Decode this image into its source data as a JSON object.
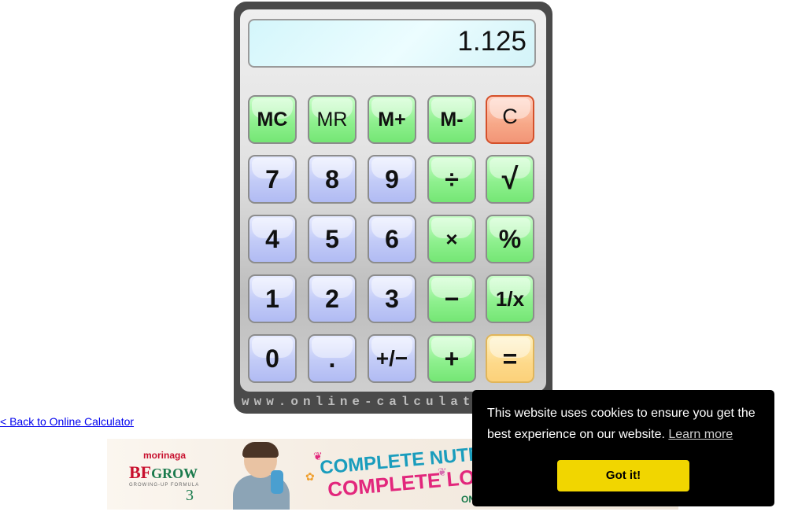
{
  "calculator": {
    "display_value": "1.125",
    "brand_text": "www.online-calculat",
    "keys": {
      "mc": "MC",
      "mr": "MR",
      "mplus": "M+",
      "mminus": "M-",
      "clear": "C",
      "k7": "7",
      "k8": "8",
      "k9": "9",
      "divide": "÷",
      "sqrt": "√",
      "k4": "4",
      "k5": "5",
      "k6": "6",
      "multiply": "×",
      "percent": "%",
      "k1": "1",
      "k2": "2",
      "k3": "3",
      "minus": "−",
      "reciprocal": "1/x",
      "k0": "0",
      "decimal": ".",
      "negate": "+/−",
      "plus": "+",
      "equals": "="
    }
  },
  "back_link": "< Back to Online Calculator",
  "ad": {
    "brand_small": "morinaga",
    "brand": "BF",
    "brand_suffix": "GROW",
    "brand_sub": "GROWING-UP FORMULA",
    "brand_number": "3",
    "headline_1": "COMPLETE NUTRITION",
    "headline_2": "COMPLETE LOVE",
    "corner_text": "ON"
  },
  "cookie_banner": {
    "message": "This website uses cookies to ensure you get the best experience on our website.",
    "learn_more": "Learn more",
    "button": "Got it!"
  },
  "colors": {
    "key_green": "#8ff08f",
    "key_blue": "#c2cbf7",
    "key_clear": "#f7a888",
    "key_equals": "#fdd98a",
    "display_bg": "#d4f6fb",
    "cookie_button": "#f1d600"
  }
}
